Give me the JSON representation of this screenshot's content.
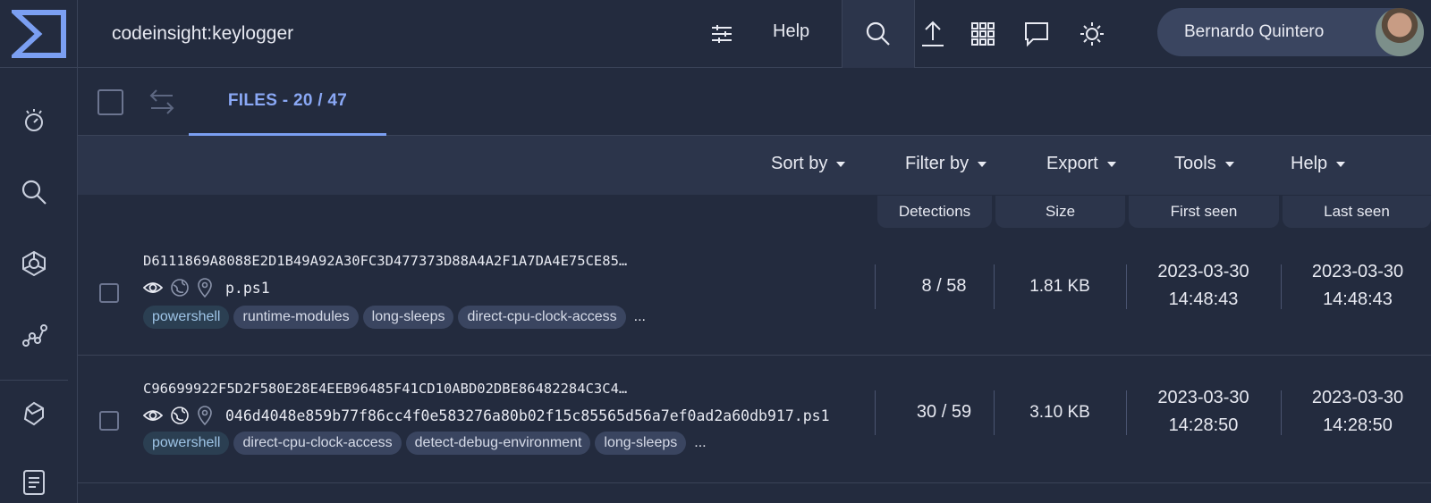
{
  "colors": {
    "background": "#232b3e",
    "panel": "#2c354b",
    "accent": "#8aa8f5",
    "tag_bg": "#3a4560",
    "tag_ps_bg": "#2b3f52"
  },
  "sidebar": {
    "items": [
      {
        "icon": "threat-hunting-icon"
      },
      {
        "icon": "search-icon"
      },
      {
        "icon": "graph-icon"
      },
      {
        "icon": "trends-icon"
      },
      {
        "icon": "bug-icon"
      },
      {
        "icon": "rules-icon"
      }
    ]
  },
  "topbar": {
    "query": "codeinsight:keylogger",
    "help_label": "Help",
    "user_name": "Bernardo Quintero"
  },
  "tabbar": {
    "tab_label": "FILES - 20 / 47"
  },
  "toolbar": {
    "sort_by": "Sort by",
    "filter_by": "Filter by",
    "export": "Export",
    "tools": "Tools",
    "help": "Help"
  },
  "columns": {
    "detections": "Detections",
    "size": "Size",
    "first_seen": "First seen",
    "last_seen": "Last seen"
  },
  "rows": [
    {
      "hash": "D6111869A8088E2D1B49A92A30FC3D477373D88A4A2F1A7DA4E75CE85…",
      "filename": "p.ps1",
      "tags": [
        "powershell",
        "runtime-modules",
        "long-sleeps",
        "direct-cpu-clock-access"
      ],
      "more": "...",
      "detections": "8 / 58",
      "size": "1.81 KB",
      "first_seen_date": "2023-03-30",
      "first_seen_time": "14:48:43",
      "last_seen_date": "2023-03-30",
      "last_seen_time": "14:48:43"
    },
    {
      "hash": "C96699922F5D2F580E28E4EEB96485F41CD10ABD02DBE86482284C3C4…",
      "filename": "046d4048e859b77f86cc4f0e583276a80b02f15c85565d56a7ef0ad2a60db917.ps1",
      "tags": [
        "powershell",
        "direct-cpu-clock-access",
        "detect-debug-environment",
        "long-sleeps"
      ],
      "more": "...",
      "detections": "30 / 59",
      "size": "3.10 KB",
      "first_seen_date": "2023-03-30",
      "first_seen_time": "14:28:50",
      "last_seen_date": "2023-03-30",
      "last_seen_time": "14:28:50"
    }
  ]
}
